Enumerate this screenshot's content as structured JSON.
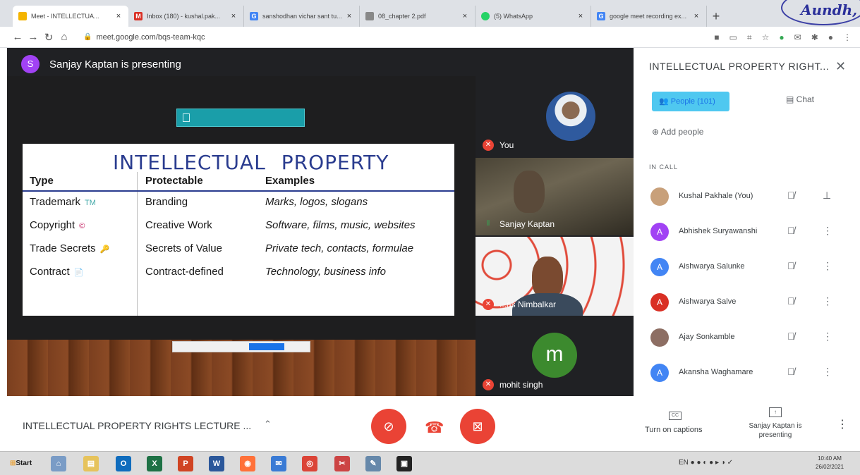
{
  "browser": {
    "tabs": [
      {
        "title": "Meet - INTELLECTUA...",
        "favicon_color": "#f4b400"
      },
      {
        "title": "Inbox (180) - kushal.pak...",
        "favicon_color": "#d93025"
      },
      {
        "title": "sanshodhan vichar sant tu...",
        "favicon_color": "#4285f4"
      },
      {
        "title": "08_chapter 2.pdf",
        "favicon_color": "#888888"
      },
      {
        "title": "(5) WhatsApp",
        "favicon_color": "#25d366"
      },
      {
        "title": "google meet recording ex...",
        "favicon_color": "#4285f4"
      }
    ],
    "new_tab_label": "+",
    "url": "meet.google.com/bqs-team-kqc",
    "stamp_text": "Aundh,"
  },
  "stage": {
    "presenter_initial": "S",
    "presenter_text": "Sanjay Kaptan is presenting"
  },
  "slide": {
    "title_word1": "INTELLECTUAL",
    "title_word2": "PROPERTY",
    "headers": {
      "type": "Type",
      "protectable": "Protectable",
      "examples": "Examples"
    },
    "rows": [
      {
        "type": "Trademark",
        "mark": "TM",
        "protectable": "Branding",
        "examples": "Marks, logos, slogans"
      },
      {
        "type": "Copyright",
        "mark": "©",
        "protectable": "Creative Work",
        "examples": "Software, films, music, websites"
      },
      {
        "type": "Trade Secrets",
        "mark": "🔑",
        "protectable": "Secrets of Value",
        "examples": "Private tech, contacts, formulae"
      },
      {
        "type": "Contract",
        "mark": "📄",
        "protectable": "Contract-defined",
        "examples": "Technology, business info"
      }
    ]
  },
  "tiles": {
    "you": "You",
    "sanjay": "Sanjay Kaptan",
    "nimbalkar": "...as Nimbalkar",
    "mohit": "mohit singh",
    "mohit_initial": "m"
  },
  "panel": {
    "title": "INTELLECTUAL PROPERTY RIGHT...",
    "people_tab": "People (101)",
    "chat_tab": "Chat",
    "add_people": "Add people",
    "in_call_label": "IN CALL",
    "participants": [
      {
        "name": "Kushal Pakhale (You)",
        "initial": "",
        "color": "#c8a07a"
      },
      {
        "name": "Abhishek Suryawanshi",
        "initial": "A",
        "color": "#a142f4"
      },
      {
        "name": "Aishwarya Salunke",
        "initial": "A",
        "color": "#4285f4"
      },
      {
        "name": "Aishwarya Salve",
        "initial": "A",
        "color": "#d93025"
      },
      {
        "name": "Ajay Sonkamble",
        "initial": "",
        "color": "#8d6e63"
      },
      {
        "name": "Akansha Waghamare",
        "initial": "A",
        "color": "#4285f4"
      }
    ]
  },
  "bottom": {
    "meeting_name": "INTELLECTUAL PROPERTY RIGHTS LECTURE ...",
    "captions_label": "Turn on captions",
    "cc_text": "CC",
    "presenting_label": "Sanjay Kaptan is presenting"
  },
  "taskbar": {
    "start_label": "Start",
    "tray_lang": "EN",
    "time": "10:40 AM",
    "date": "26/02/2021"
  }
}
